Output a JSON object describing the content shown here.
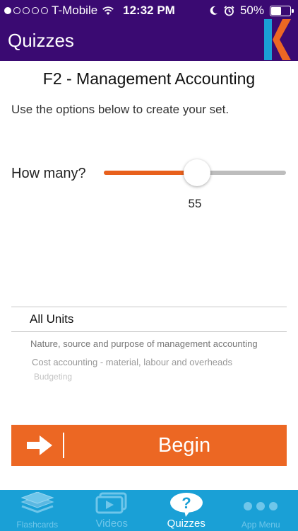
{
  "status_bar": {
    "carrier": "T-Mobile",
    "time": "12:32 PM",
    "battery": "50%",
    "battery_level": 0.5,
    "signal_bars": 1
  },
  "nav": {
    "title": "Quizzes"
  },
  "main": {
    "title": "F2 - Management Accounting",
    "instructions": "Use the options below to create your set.",
    "how_many_label": "How many?",
    "slider": {
      "value": "55",
      "fraction": 0.51
    },
    "picker": {
      "selected": "All Units",
      "options": [
        "Nature, source and purpose of management accounting",
        "Cost accounting - material, labour and overheads",
        "Budgeting"
      ]
    },
    "begin_label": "Begin"
  },
  "tabbar": {
    "tabs": [
      {
        "label": "Flashcards",
        "icon": "layers-icon",
        "active": false
      },
      {
        "label": "Videos",
        "icon": "play-video-icon",
        "active": false
      },
      {
        "label": "Quizzes",
        "icon": "question-bubble-icon",
        "active": true
      },
      {
        "label": "App Menu",
        "icon": "more-dots-icon",
        "active": false
      }
    ]
  },
  "colors": {
    "nav_background": "#3a0a72",
    "accent_orange": "#ec6723",
    "slider_fill": "#e8601c",
    "tabbar_background": "#1aa0d6",
    "logo_blue": "#1aa0d6",
    "logo_orange": "#ec6723"
  }
}
